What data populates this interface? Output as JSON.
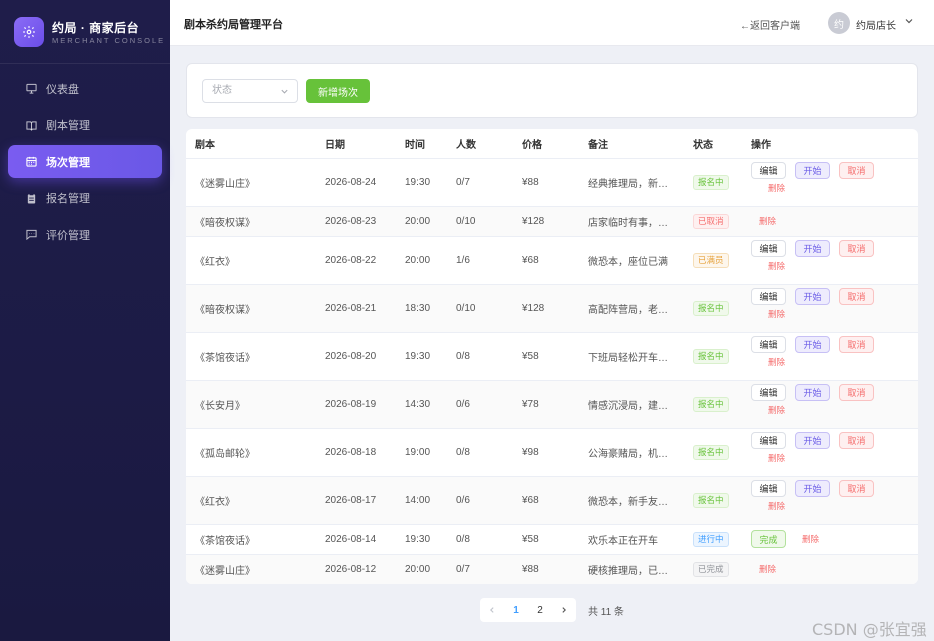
{
  "brand": {
    "title": "约局 · 商家后台",
    "subtitle": "MERCHANT CONSOLE",
    "logo_icon": "gear-icon"
  },
  "sidebar": {
    "items": [
      {
        "label": "仪表盘",
        "icon": "monitor-icon",
        "active": false
      },
      {
        "label": "剧本管理",
        "icon": "book-icon",
        "active": false
      },
      {
        "label": "场次管理",
        "icon": "calendar-icon",
        "active": true
      },
      {
        "label": "报名管理",
        "icon": "clipboard-icon",
        "active": false
      },
      {
        "label": "评价管理",
        "icon": "comment-icon",
        "active": false
      }
    ]
  },
  "header": {
    "title": "剧本杀约局管理平台",
    "back_link": "←返回客户端",
    "avatar_char": "约",
    "user_name": "约局店长"
  },
  "filter": {
    "status_placeholder": "状态",
    "add_button": "新增场次"
  },
  "table": {
    "columns": [
      "剧本",
      "日期",
      "时间",
      "人数",
      "价格",
      "备注",
      "状态",
      "操作"
    ],
    "actions": {
      "edit": "编辑",
      "start": "开始",
      "cancel": "取消",
      "delete": "删除",
      "finish": "完成"
    },
    "rows": [
      {
        "script": "《迷雾山庄》",
        "date": "2026-08-24",
        "time": "19:30",
        "people": "0/7",
        "price": "¥88",
        "note": "经典推理局，新…",
        "status": "报名中",
        "status_type": "recruiting",
        "ops": "full"
      },
      {
        "script": "《暗夜权谋》",
        "date": "2026-08-23",
        "time": "20:00",
        "people": "0/10",
        "price": "¥128",
        "note": "店家临时有事，…",
        "status": "已取消",
        "status_type": "cancelled",
        "ops": "delete"
      },
      {
        "script": "《红衣》",
        "date": "2026-08-22",
        "time": "20:00",
        "people": "1/6",
        "price": "¥68",
        "note": "微恐本，座位已满",
        "status": "已满员",
        "status_type": "full",
        "ops": "full"
      },
      {
        "script": "《暗夜权谋》",
        "date": "2026-08-21",
        "time": "18:30",
        "people": "0/10",
        "price": "¥128",
        "note": "高配阵营局，老…",
        "status": "报名中",
        "status_type": "recruiting",
        "ops": "full"
      },
      {
        "script": "《茶馆夜话》",
        "date": "2026-08-20",
        "time": "19:30",
        "people": "0/8",
        "price": "¥58",
        "note": "下班局轻松开车…",
        "status": "报名中",
        "status_type": "recruiting",
        "ops": "full"
      },
      {
        "script": "《长安月》",
        "date": "2026-08-19",
        "time": "14:30",
        "people": "0/6",
        "price": "¥78",
        "note": "情感沉浸局，建…",
        "status": "报名中",
        "status_type": "recruiting",
        "ops": "full"
      },
      {
        "script": "《孤岛邮轮》",
        "date": "2026-08-18",
        "time": "19:00",
        "people": "0/8",
        "price": "¥98",
        "note": "公海豪赌局，机…",
        "status": "报名中",
        "status_type": "recruiting",
        "ops": "full"
      },
      {
        "script": "《红衣》",
        "date": "2026-08-17",
        "time": "14:00",
        "people": "0/6",
        "price": "¥68",
        "note": "微恐本，新手友…",
        "status": "报名中",
        "status_type": "recruiting",
        "ops": "full"
      },
      {
        "script": "《茶馆夜话》",
        "date": "2026-08-14",
        "time": "19:30",
        "people": "0/8",
        "price": "¥58",
        "note": "欢乐本正在开车",
        "status": "进行中",
        "status_type": "ongoing",
        "ops": "finish"
      },
      {
        "script": "《迷雾山庄》",
        "date": "2026-08-12",
        "time": "20:00",
        "people": "0/7",
        "price": "¥88",
        "note": "硬核推理局，已…",
        "status": "已完成",
        "status_type": "done",
        "ops": "delete"
      }
    ]
  },
  "pagination": {
    "pages": [
      "1",
      "2"
    ],
    "current": "1",
    "total": "共 11 条"
  },
  "watermark": "CSDN @张宜强",
  "colors": {
    "accent": "#7a5cf0",
    "success": "#67c23a",
    "danger": "#f56c6c",
    "sidebar_bg": "#1f1d4a"
  }
}
